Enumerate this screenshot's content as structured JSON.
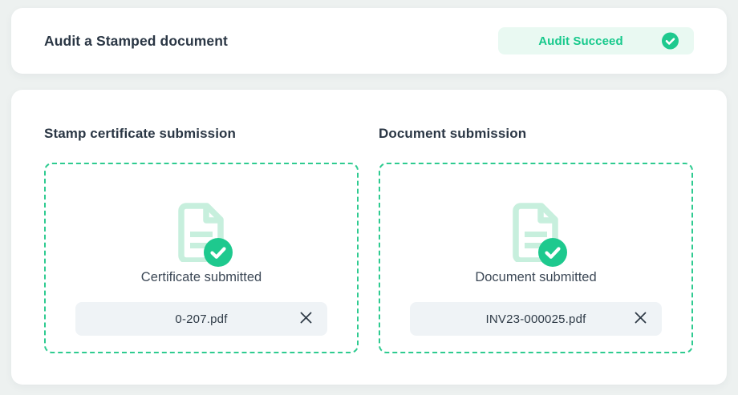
{
  "colors": {
    "page_bg": "#edf1f0",
    "accent_green": "#1ec98e",
    "mint_light": "#c7efdd",
    "badge_bg": "#e9f9f2",
    "badge_text": "#17c98c",
    "dashed_border": "#2ecb90",
    "chip_bg": "#eff3f6",
    "heading_text": "#2a3644",
    "body_text": "#3c4856"
  },
  "header": {
    "title": "Audit a Stamped document",
    "badge": {
      "label": "Audit Succeed",
      "icon": "check-circle"
    }
  },
  "main": {
    "sections": [
      {
        "heading": "Stamp certificate submission",
        "icon": "document-check",
        "status_text": "Certificate submitted",
        "file_name": "0-207.pdf"
      },
      {
        "heading": "Document submission",
        "icon": "document-check",
        "status_text": "Document submitted",
        "file_name": "INV23-000025.pdf"
      }
    ]
  }
}
